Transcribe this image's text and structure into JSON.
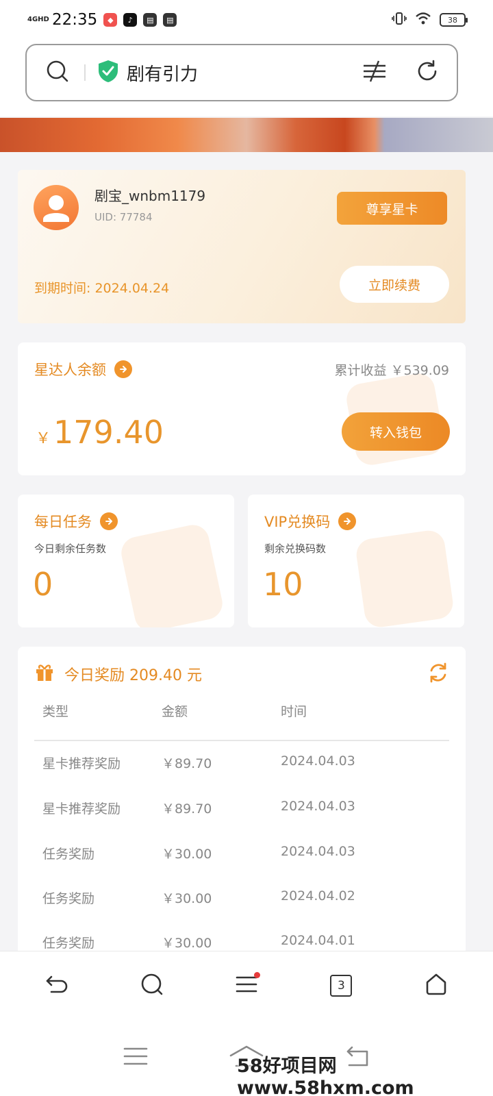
{
  "status_bar": {
    "network": "4GHD",
    "time": "22:35",
    "battery": "38"
  },
  "url_bar": {
    "site_title": "剧有引力"
  },
  "vip_card": {
    "username": "剧宝_wnbm1179",
    "uid": "UID: 77784",
    "star_card_button": "尊享星卡",
    "expiry": "到期时间: 2024.04.24",
    "renew_button": "立即续费"
  },
  "balance": {
    "title": "星达人余额",
    "cumulative": "累计收益 ￥539.09",
    "currency": "￥",
    "amount": "179.40",
    "wallet_button": "转入钱包"
  },
  "daily_task": {
    "title": "每日任务",
    "subtitle": "今日剩余任务数",
    "count": "0"
  },
  "vip_code": {
    "title": "VIP兑换码",
    "subtitle": "剩余兑换码数",
    "count": "10"
  },
  "rewards": {
    "title": "今日奖励 209.40 元",
    "headers": [
      "类型",
      "金额",
      "时间"
    ],
    "rows": [
      {
        "type": "星卡推荐奖励",
        "amount": "￥89.70",
        "date": "2024.04.03"
      },
      {
        "type": "星卡推荐奖励",
        "amount": "￥89.70",
        "date": "2024.04.03"
      },
      {
        "type": "任务奖励",
        "amount": "￥30.00",
        "date": "2024.04.03"
      },
      {
        "type": "任务奖励",
        "amount": "￥30.00",
        "date": "2024.04.02"
      },
      {
        "type": "任务奖励",
        "amount": "￥30.00",
        "date": "2024.04.01"
      }
    ]
  },
  "toolbar": {
    "tab_count": "3"
  },
  "watermark": "58好项目网www.58hxm.com",
  "colors": {
    "accent": "#e48a22",
    "accent_button": "#ef9530",
    "shield": "#2dbd7a",
    "badge_red": "#e63b3b"
  }
}
